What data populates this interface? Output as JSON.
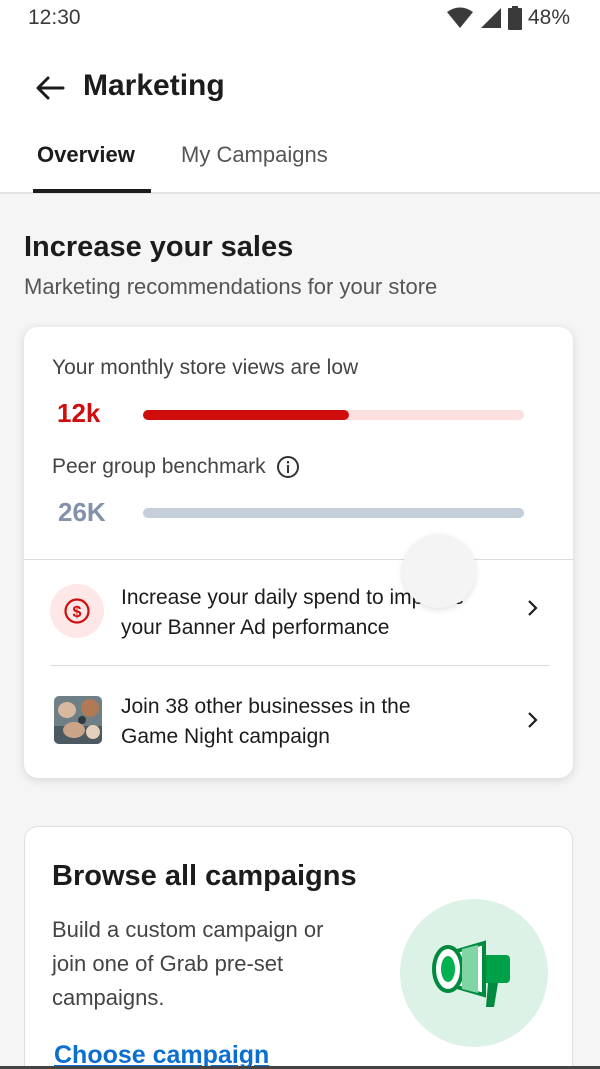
{
  "status_bar": {
    "time": "12:30",
    "battery": "48%",
    "icons": [
      "wifi-icon",
      "signal-icon",
      "battery-icon"
    ]
  },
  "header": {
    "title": "Marketing",
    "tabs": [
      {
        "label": "Overview",
        "active": true
      },
      {
        "label": "My Campaigns",
        "active": false
      }
    ]
  },
  "section": {
    "title": "Increase your sales",
    "subtitle": "Marketing recommendations for your store"
  },
  "stats_card": {
    "views_label": "Your monthly store views are low",
    "views_value": "12k",
    "views_progress": 0.54,
    "benchmark_label": "Peer group benchmark",
    "benchmark_value": "26K",
    "benchmark_progress": 1.0,
    "colors": {
      "low": "#d00d0d",
      "low_track": "#fbe0df",
      "benchmark": "#c5cfd9"
    },
    "recommendations": [
      {
        "icon": "dollar-icon",
        "text_line1": "Increase your daily spend to improve",
        "text_line2": "your Banner Ad performance"
      },
      {
        "icon": "game-night-thumbnail",
        "text_line1": "Join 38 other businesses in the",
        "text_line2": "Game Night campaign"
      }
    ]
  },
  "browse_card": {
    "title": "Browse all campaigns",
    "description_line1": "Build a custom campaign or",
    "description_line2": "join one of Grab pre-set",
    "description_line3": "campaigns.",
    "link": "Choose campaign",
    "icon": "megaphone-icon",
    "accent": "#00b14f"
  }
}
